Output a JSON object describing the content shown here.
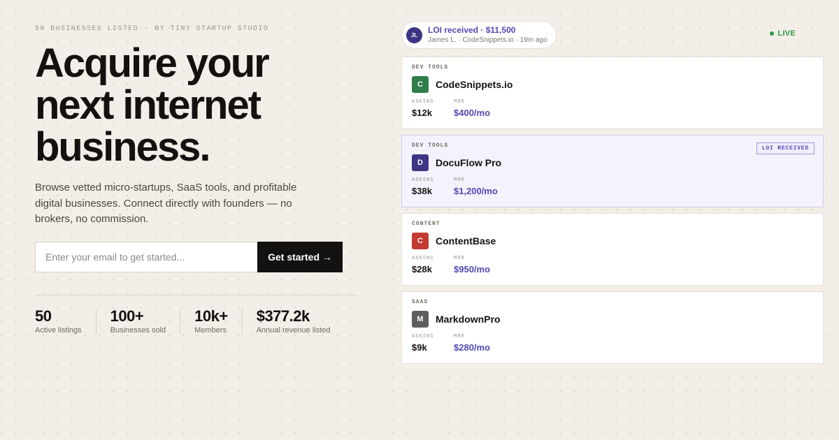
{
  "hero": {
    "eyebrow_count": "50 BUSINESSES LISTED",
    "eyebrow_separator": "·",
    "eyebrow_by": "BY TINY STARTUP STUDIO",
    "headline": [
      "Acquire your",
      "next internet",
      "business."
    ],
    "subheadline": "Browse vetted micro-startups, SaaS tools, and profitable digital businesses. Connect directly with founders — no brokers, no commission.",
    "email_placeholder": "Enter your email to get started...",
    "email_value": "",
    "cta_label": "Get started →"
  },
  "stats": [
    {
      "value": "50",
      "label": "Active listings"
    },
    {
      "value": "100+",
      "label": "Businesses sold"
    },
    {
      "value": "10k+",
      "label": "Members"
    },
    {
      "value": "$377.2k",
      "label": "Annual revenue listed"
    }
  ],
  "notification": {
    "avatar_initials": "JL",
    "title": "LOI received · $11,500",
    "meta": "James L. · CodeSnippets.io · 19m ago",
    "avatar_color": "#3b3583"
  },
  "live": {
    "label": "LIVE",
    "color": "#2f9a47"
  },
  "listings": [
    {
      "category": "DEV TOOLS",
      "logo_letter": "C",
      "logo_color": "#2f7d4a",
      "name": "CodeSnippets.io",
      "asking_label": "ASKING",
      "asking": "$12k",
      "mrr_label": "MRR",
      "mrr": "$400/mo",
      "badge": "",
      "highlighted": false
    },
    {
      "category": "DEV TOOLS",
      "logo_letter": "D",
      "logo_color": "#3b3583",
      "name": "DocuFlow Pro",
      "asking_label": "ASKING",
      "asking": "$38k",
      "mrr_label": "MRR",
      "mrr": "$1,200/mo",
      "badge": "LOI RECEIVED",
      "highlighted": true
    },
    {
      "category": "CONTENT",
      "logo_letter": "C",
      "logo_color": "#c23b30",
      "name": "ContentBase",
      "asking_label": "ASKING",
      "asking": "$28k",
      "mrr_label": "MRR",
      "mrr": "$950/mo",
      "badge": "",
      "highlighted": false
    },
    {
      "category": "SAAS",
      "logo_letter": "M",
      "logo_color": "#5e5e5e",
      "name": "MarkdownPro",
      "asking_label": "ASKING",
      "asking": "$9k",
      "mrr_label": "MRR",
      "mrr": "$280/mo",
      "badge": "",
      "highlighted": false
    }
  ],
  "colors": {
    "accent": "#5248b5",
    "dark": "#141210",
    "background": "#f3efe8"
  }
}
